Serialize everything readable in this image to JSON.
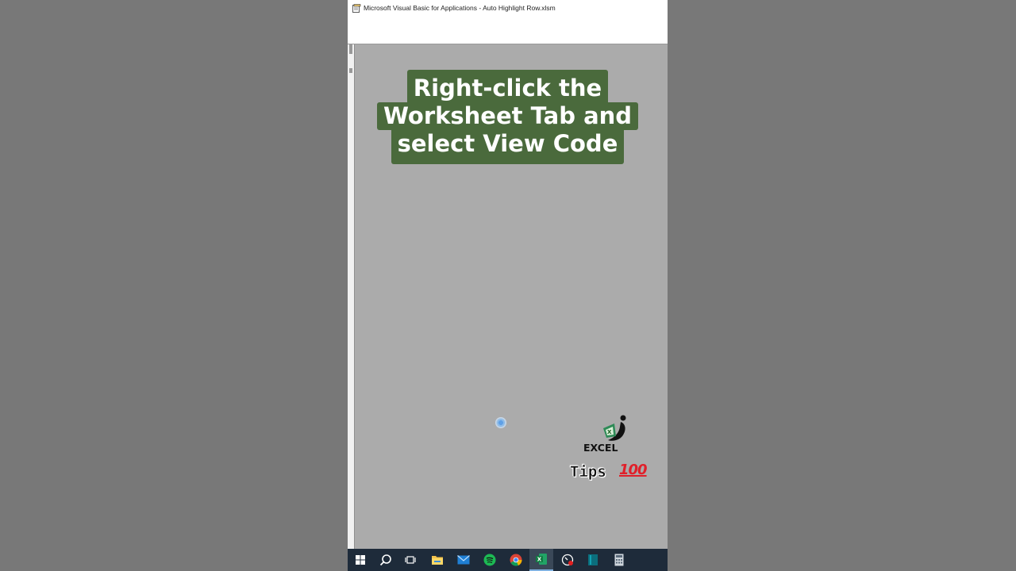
{
  "window": {
    "title": "Microsoft Visual Basic for Applications - Auto Highlight Row.xlsm",
    "app_icon": "vba-icon"
  },
  "caption": {
    "lines": [
      "Right-click the",
      "Worksheet Tab and",
      "select View Code"
    ],
    "background": "#4a6a3c"
  },
  "watermark": {
    "brand": "EXCEL",
    "tips": "Tips",
    "emoji": "100"
  },
  "taskbar": {
    "items": [
      {
        "icon": "windows-start-icon"
      },
      {
        "icon": "search-icon"
      },
      {
        "icon": "task-view-icon"
      },
      {
        "icon": "file-explorer-icon"
      },
      {
        "icon": "mail-icon"
      },
      {
        "icon": "spotify-icon"
      },
      {
        "icon": "chrome-icon"
      },
      {
        "icon": "excel-icon",
        "active": true
      },
      {
        "icon": "screen-recorder-icon"
      },
      {
        "icon": "app-icon"
      },
      {
        "icon": "calculator-icon"
      }
    ]
  }
}
